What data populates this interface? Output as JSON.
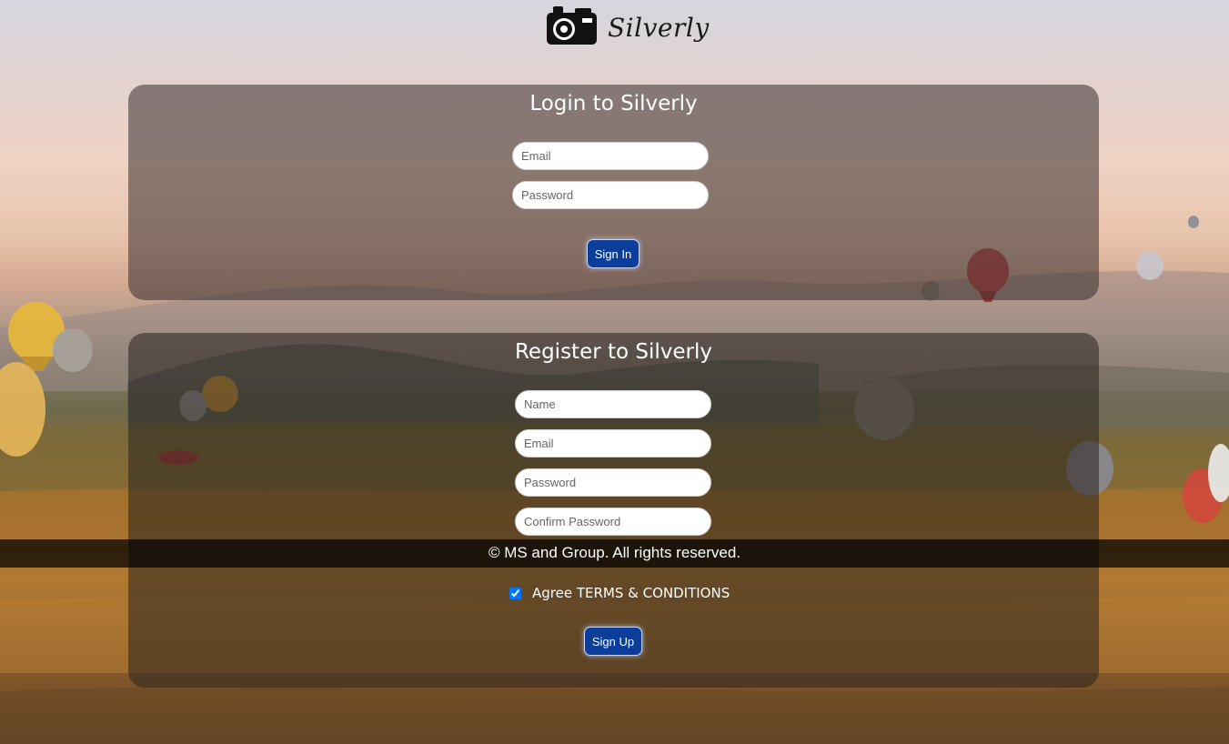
{
  "header": {
    "logo_text": "Silverly",
    "logo_icon": "camera-icon"
  },
  "login": {
    "title": "Login to Silverly",
    "email_placeholder": "Email",
    "password_placeholder": "Password",
    "submit_label": "Sign In"
  },
  "register": {
    "title": "Register to Silverly",
    "name_placeholder": "Name",
    "email_placeholder": "Email",
    "password_placeholder": "Password",
    "confirm_placeholder": "Confirm Password",
    "agree_label": "Agree TERMS & CONDITIONS",
    "agree_checked": true,
    "submit_label": "Sign Up"
  },
  "footer": {
    "text": "© MS and Group. All rights reserved."
  },
  "colors": {
    "button_bg": "#0b3e9a",
    "panel_overlay": "rgba(55,45,45,0.55)"
  }
}
